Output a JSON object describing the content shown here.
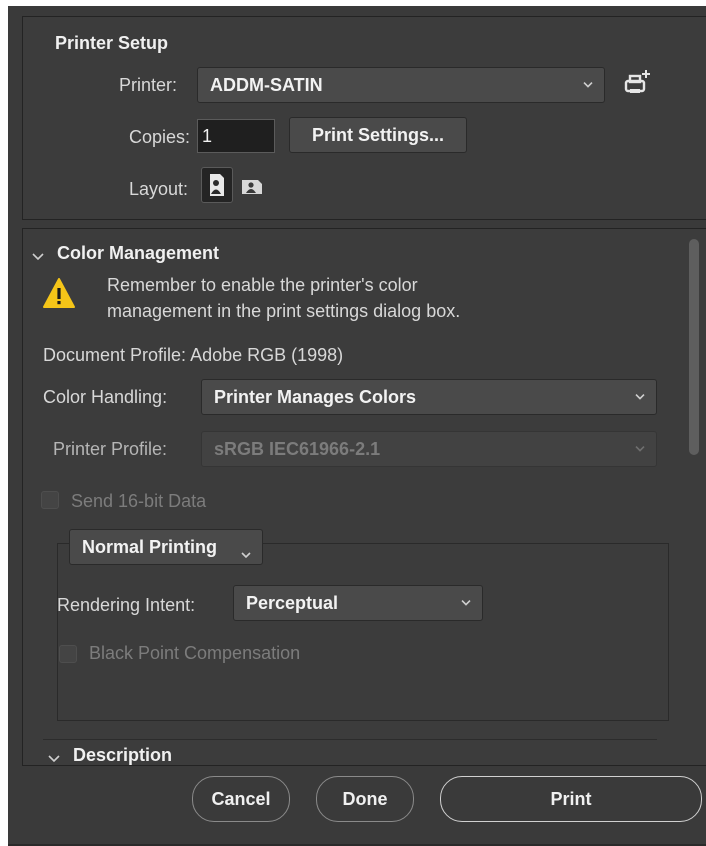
{
  "printer_setup": {
    "heading": "Printer Setup",
    "printer_label": "Printer:",
    "printer_value": "ADDM-SATIN",
    "copies_label": "Copies:",
    "copies_value": "1",
    "print_settings_label": "Print Settings...",
    "layout_label": "Layout:",
    "icons": [
      "add-printer-icon",
      "portrait-layout-icon",
      "landscape-layout-icon"
    ]
  },
  "color_management": {
    "heading": "Color Management",
    "warning_line1": "Remember to enable the printer's color",
    "warning_line2": "management in the print settings dialog box.",
    "document_profile": "Document Profile: Adobe RGB (1998)",
    "color_handling_label": "Color Handling:",
    "color_handling_value": "Printer Manages Colors",
    "printer_profile_label": "Printer Profile:",
    "printer_profile_value": "sRGB IEC61966-2.1",
    "send_16bit_label": "Send 16-bit Data",
    "send_16bit_checked": false,
    "mode_value": "Normal Printing",
    "rendering_intent_label": "Rendering Intent:",
    "rendering_intent_value": "Perceptual",
    "black_point_label": "Black Point Compensation",
    "black_point_checked": false,
    "icons": [
      "collapse-chevron-icon",
      "warning-icon"
    ]
  },
  "description": {
    "heading": "Description"
  },
  "footer": {
    "cancel_label": "Cancel",
    "done_label": "Done",
    "print_label": "Print"
  },
  "colors": {
    "panel_bg": "#3c3c3c",
    "field_bg": "#4a4a4a",
    "warning_yellow": "#f5c518"
  }
}
